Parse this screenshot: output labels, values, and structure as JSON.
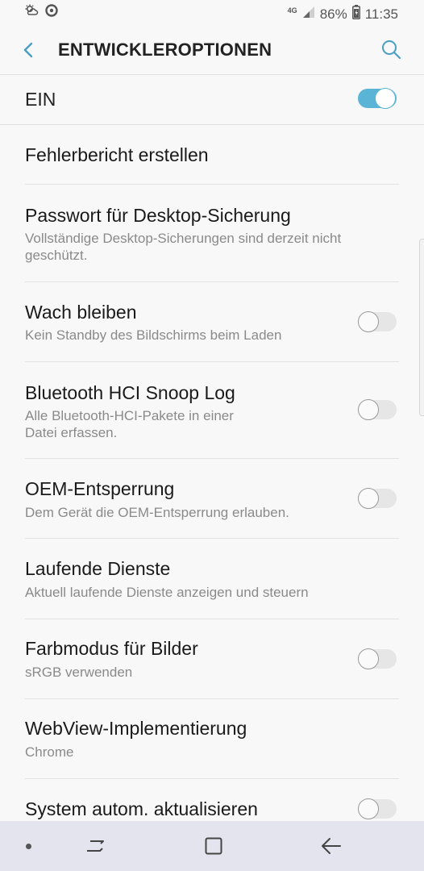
{
  "status_bar": {
    "network": "4G",
    "battery": "86%",
    "time": "11:35"
  },
  "header": {
    "title": "ENTWICKLEROPTIONEN"
  },
  "master_switch": {
    "label": "EIN",
    "state": "on"
  },
  "items": [
    {
      "title": "Fehlerbericht erstellen",
      "subtitle": ""
    },
    {
      "title": "Passwort für Desktop-Sicherung",
      "subtitle": "Vollständige Desktop-Sicherungen sind derzeit nicht geschützt."
    },
    {
      "title": "Wach bleiben",
      "subtitle": "Kein Standby des Bildschirms beim Laden",
      "toggle": "off"
    },
    {
      "title": "Bluetooth HCI Snoop Log",
      "subtitle": "Alle Bluetooth-HCI-Pakete in einer Datei erfassen.",
      "toggle": "off"
    },
    {
      "title": "OEM-Entsperrung",
      "subtitle": "Dem Gerät die OEM-Entsperrung erlauben.",
      "toggle": "off"
    },
    {
      "title": "Laufende Dienste",
      "subtitle": "Aktuell laufende Dienste anzeigen und steuern"
    },
    {
      "title": "Farbmodus für Bilder",
      "subtitle": "sRGB verwenden",
      "toggle": "off"
    },
    {
      "title": "WebView-Implementierung",
      "subtitle": "Chrome"
    },
    {
      "title": "System autom. aktualisieren",
      "subtitle": "",
      "toggle": "off"
    }
  ],
  "colors": {
    "accent": "#5ab4d6",
    "background": "#f8f8f8",
    "navbar": "#e4e4ee"
  },
  "icons": [
    "weather-icon",
    "notification-icon",
    "signal-icon",
    "battery-icon",
    "back-arrow-icon",
    "search-icon",
    "recent-apps-icon",
    "home-icon",
    "nav-back-icon"
  ]
}
